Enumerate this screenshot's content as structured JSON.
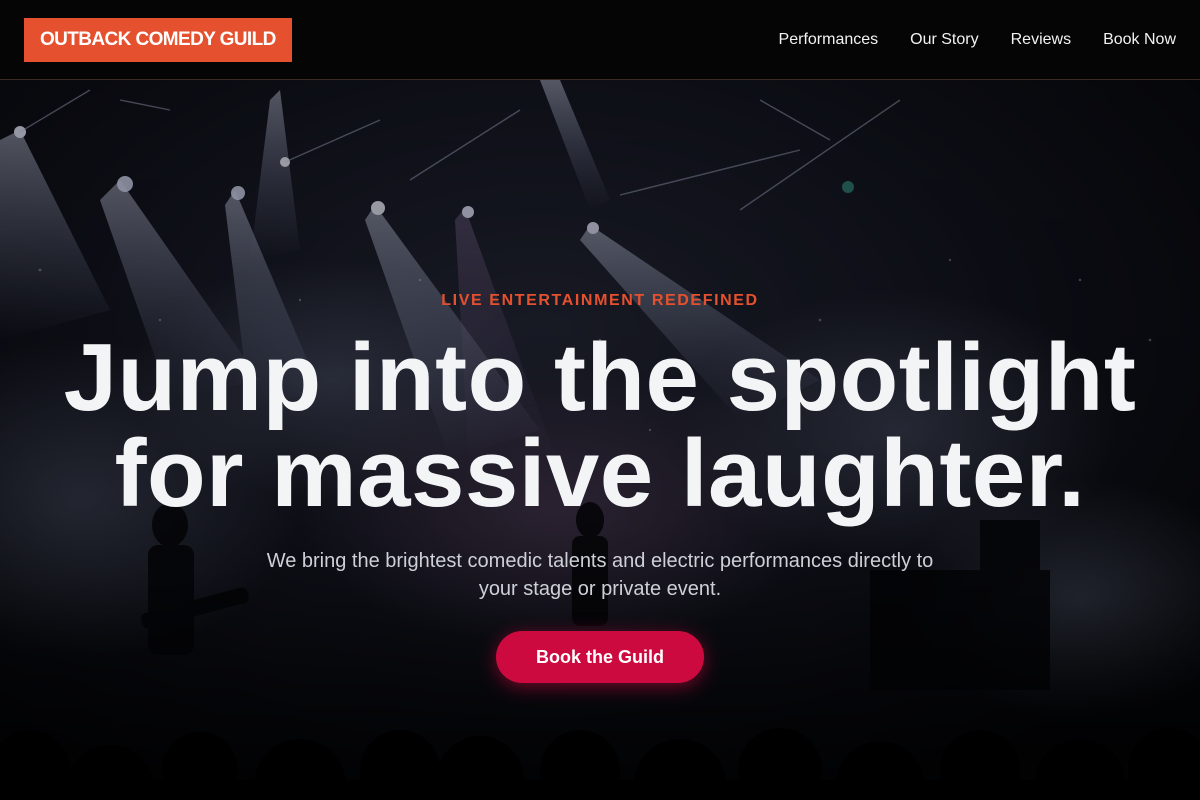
{
  "header": {
    "logo_text": "OUTBACK COMEDY GUILD",
    "nav": [
      {
        "label": "Performances"
      },
      {
        "label": "Our Story"
      },
      {
        "label": "Reviews"
      },
      {
        "label": "Book Now"
      }
    ]
  },
  "hero": {
    "eyebrow": "LIVE ENTERTAINMENT REDEFINED",
    "headline_line1": "Jump into the spotlight",
    "headline_line2": "for massive laughter.",
    "subtext": "We bring the brightest comedic talents and electric performances directly to your stage or private event.",
    "cta_label": "Book the Guild",
    "background_image": "concert-stage-photo"
  },
  "colors": {
    "brand_accent": "#e5512f",
    "cta": "#cc0a3f",
    "header_bg": "#050505",
    "headline": "#f3f4f6"
  }
}
